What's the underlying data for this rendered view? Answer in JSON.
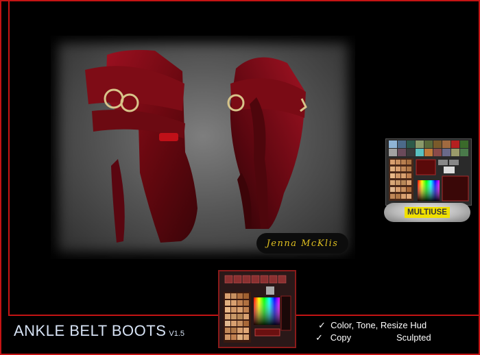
{
  "product": {
    "title": "ANKLE BELT BOOTS",
    "version": "V1.5"
  },
  "signature": "Jenna McKlis",
  "badge": "MULTIUSE",
  "features": [
    {
      "check": "✓",
      "label": "Color, Tone, Resize Hud"
    },
    {
      "check": "✓",
      "label": "Copy"
    },
    {
      "check": "",
      "label": "Sculpted"
    }
  ],
  "colors": {
    "frame": "#c41414",
    "boot": "#7a0a12",
    "title_text": "#d6e2f4",
    "signature_text": "#e0c020",
    "badge_bg": "#f0e000"
  }
}
